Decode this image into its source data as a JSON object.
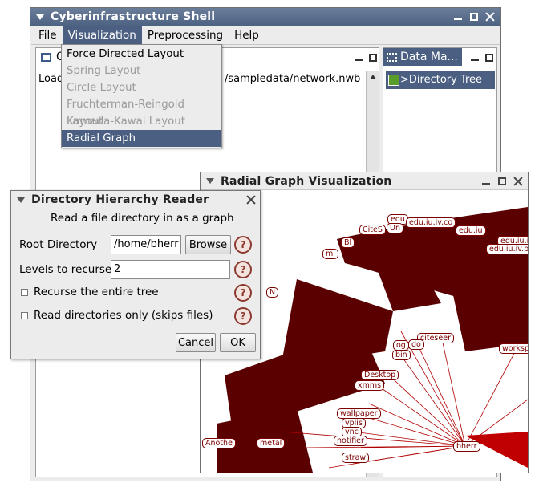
{
  "main_window": {
    "title": "Cyberinfrastructure Shell"
  },
  "menubar": {
    "items": [
      "File",
      "Visualization",
      "Preprocessing",
      "Help"
    ]
  },
  "console": {
    "tab_initial": "C",
    "text_start": "Load",
    "text_path": "/sampledata/network.nwb"
  },
  "data_manager": {
    "tab_label": "Data Ma...",
    "tree_item": ">Directory Tree"
  },
  "visualization_menu": {
    "items": [
      {
        "label": "Force Directed Layout",
        "state": "enabled"
      },
      {
        "label": "Spring Layout",
        "state": "disabled"
      },
      {
        "label": "Circle Layout",
        "state": "disabled"
      },
      {
        "label": "Fruchterman-Reingold Layout",
        "state": "disabled"
      },
      {
        "label": "Kamada-Kawai Layout",
        "state": "disabled"
      },
      {
        "label": "Radial Graph",
        "state": "selected"
      }
    ]
  },
  "radial_window": {
    "title": "Radial Graph Visualization",
    "labels": [
      "edu",
      "edu.iu.iv.co",
      "edu.iu",
      "edu.iu.iv",
      "edu.iu.iv.p",
      "CiteS",
      "Un",
      "Bl",
      "ml",
      "N",
      "citeseer",
      "og",
      "do",
      "bin",
      "workspa",
      "Desktop",
      "xmms",
      "wallpaper",
      "vplis",
      "vnc",
      "notifier",
      "straw",
      "bherr",
      "Anothe",
      "metal"
    ]
  },
  "dialog": {
    "title": "Directory Hierarchy Reader",
    "description": "Read a file directory in as a graph",
    "root_label": "Root Directory",
    "root_value": "/home/bherr",
    "browse_label": "Browse",
    "levels_label": "Levels to recurse",
    "levels_value": "2",
    "recurse_label": "Recurse the entire tree",
    "dirs_only_label": "Read directories only (skips files)",
    "help_glyph": "?",
    "cancel_label": "Cancel",
    "ok_label": "OK"
  },
  "colors": {
    "title_dark": "#4e6282",
    "menu_highlight": "#4b5f82",
    "edge_dark": "#5a0000",
    "edge_red": "#c00000"
  }
}
